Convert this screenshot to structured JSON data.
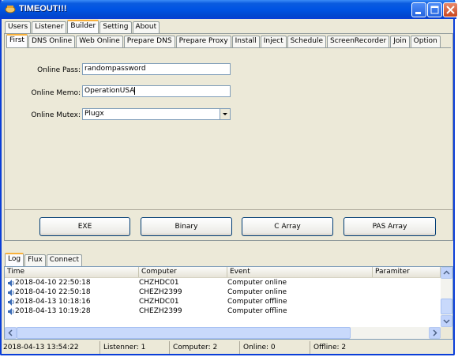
{
  "window": {
    "title": "TIMEOUT!!!"
  },
  "main_tabs": [
    "Users",
    "Listener",
    "Builder",
    "Setting",
    "About"
  ],
  "sub_tabs": [
    "First",
    "DNS Online",
    "Web Online",
    "Prepare DNS",
    "Prepare Proxy",
    "Install",
    "Inject",
    "Schedule",
    "ScreenRecorder",
    "Join",
    "Option"
  ],
  "form": {
    "online_pass_label": "Online Pass:",
    "online_pass_value": "randompassword",
    "online_memo_label": "Online Memo:",
    "online_memo_value": "OperationUSA",
    "online_mutex_label": "Online Mutex:",
    "online_mutex_value": "Plugx"
  },
  "build_buttons": [
    "EXE",
    "Binary",
    "C Array",
    "PAS Array"
  ],
  "log_tabs": [
    "Log",
    "Flux",
    "Connect"
  ],
  "log_table": {
    "columns": [
      "Time",
      "Computer",
      "Event",
      "Paramiter"
    ],
    "rows": [
      {
        "time": "2018-04-10 22:50:18",
        "computer": "CHZHDC01",
        "event": "Computer online",
        "param": ""
      },
      {
        "time": "2018-04-10 22:50:18",
        "computer": "CHEZH2399",
        "event": "Computer online",
        "param": ""
      },
      {
        "time": "2018-04-13 10:18:16",
        "computer": "CHZHDC01",
        "event": "Computer offline",
        "param": ""
      },
      {
        "time": "2018-04-13 10:19:28",
        "computer": "CHEZH2399",
        "event": "Computer offline",
        "param": ""
      }
    ]
  },
  "statusbar": {
    "datetime": "2018-04-13 13:54:22",
    "listener": "Listenner: 1",
    "computer": "Computer: 2",
    "online": "Online: 0",
    "offline": "Offline: 2"
  },
  "icons": {
    "title": "app-icon",
    "row": "speaker-icon"
  },
  "colors": {
    "titlebar": "#0054e3",
    "face": "#ece9d8",
    "active_tab_accent": "#f8b13b"
  }
}
